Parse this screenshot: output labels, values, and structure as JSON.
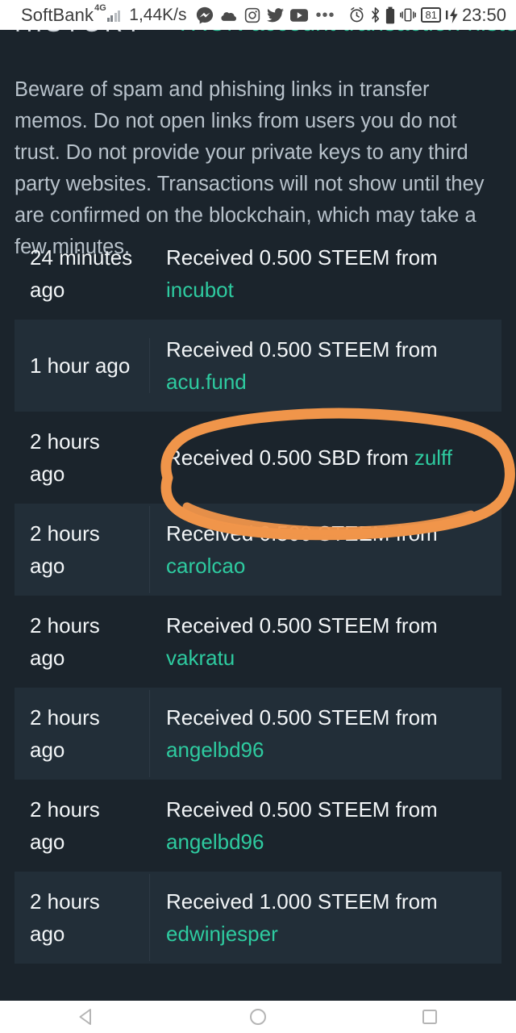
{
  "statusbar": {
    "carrier": "SoftBank",
    "network_generation": "4G",
    "data_speed": "1,44K/s",
    "battery_percent": "81",
    "clock": "23:50",
    "app_icons": [
      "messenger-icon",
      "cloud-icon",
      "instagram-icon",
      "twitter-icon",
      "youtube-icon",
      "more-dots-icon"
    ],
    "system_icons": [
      "alarm-icon",
      "bluetooth-icon",
      "battery-icon",
      "vibrate-icon",
      "battery-percent-badge",
      "charging-bolt-icon"
    ]
  },
  "header": {
    "title": "HISTORY",
    "subtitle": "TRON account transaction history",
    "chevron": "▾"
  },
  "warning": {
    "text": "Beware of spam and phishing links in transfer memos. Do not open links from users you do not trust. Do not provide your private keys to any third party websites. Transactions will not show until they are confirmed on the blockchain, which may take a few minutes."
  },
  "transactions": [
    {
      "time": "24 minutes ago",
      "description": "Received 0.500 STEEM from ",
      "user": "incubot",
      "amount": "0.500",
      "asset": "STEEM",
      "striped": false,
      "highlighted": false
    },
    {
      "time": "1 hour ago",
      "description": "Received 0.500 STEEM from ",
      "user": "acu.fund",
      "amount": "0.500",
      "asset": "STEEM",
      "striped": true,
      "highlighted": false
    },
    {
      "time": "2 hours ago",
      "description": "Received 0.500 SBD from ",
      "user": "zulff",
      "amount": "0.500",
      "asset": "SBD",
      "striped": false,
      "highlighted": true
    },
    {
      "time": "2 hours ago",
      "description": "Received 0.500 STEEM from ",
      "user": "carolcao",
      "amount": "0.500",
      "asset": "STEEM",
      "striped": true,
      "highlighted": false
    },
    {
      "time": "2 hours ago",
      "description": "Received 0.500 STEEM from ",
      "user": "vakratu",
      "amount": "0.500",
      "asset": "STEEM",
      "striped": false,
      "highlighted": false
    },
    {
      "time": "2 hours ago",
      "description": "Received 0.500 STEEM from ",
      "user": "angelbd96",
      "amount": "0.500",
      "asset": "STEEM",
      "striped": true,
      "highlighted": false
    },
    {
      "time": "2 hours ago",
      "description": "Received 0.500 STEEM from ",
      "user": "angelbd96",
      "amount": "0.500",
      "asset": "STEEM",
      "striped": false,
      "highlighted": false
    },
    {
      "time": "2 hours ago",
      "description": "Received 1.000 STEEM from ",
      "user": "edwinjesper",
      "amount": "1.000",
      "asset": "STEEM",
      "striped": true,
      "highlighted": false
    }
  ],
  "annotation": {
    "type": "hand-drawn-circle",
    "color": "#f0954a",
    "target_row_index": 2
  },
  "navbar": {
    "back_label": "back-button",
    "home_label": "home-button",
    "recents_label": "recents-button"
  },
  "colors": {
    "page_background": "#1b242c",
    "row_striped": "#222e38",
    "link_teal": "#2ecba0",
    "text_primary": "#f2f5f7",
    "text_muted": "#b8c2cb",
    "annotation_orange": "#f0954a"
  }
}
